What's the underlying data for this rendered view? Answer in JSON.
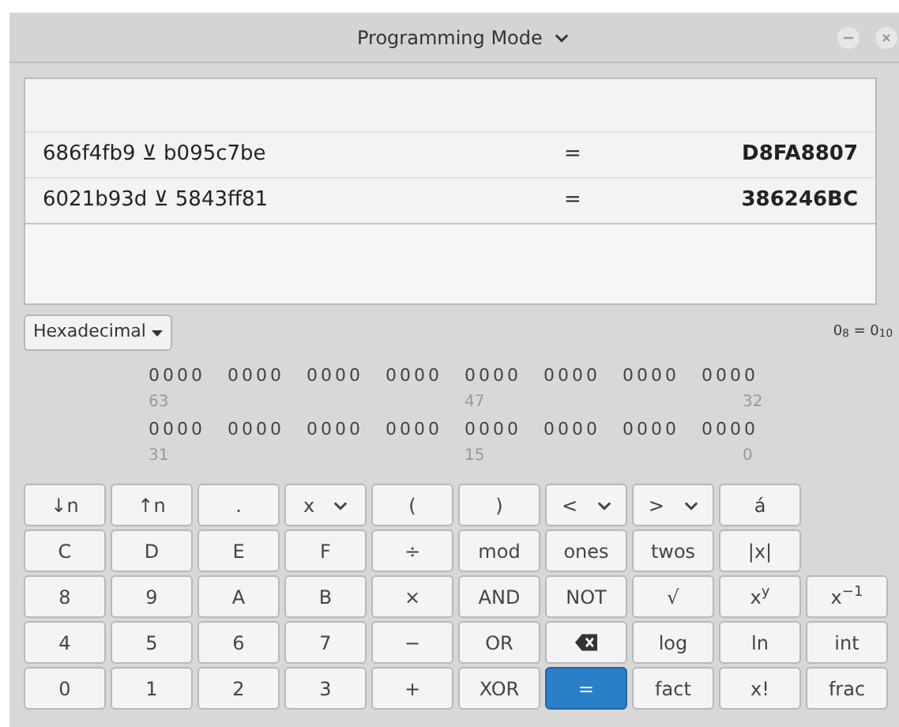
{
  "window": {
    "title": "Programming Mode"
  },
  "history": [
    {
      "expression": "686f4fb9 ⊻ b095c7be",
      "equals": "=",
      "result": "D8FA8807"
    },
    {
      "expression": "6021b93d ⊻ 5843ff81",
      "equals": "=",
      "result": "386246BC"
    }
  ],
  "number_format": {
    "label": "Hexadecimal"
  },
  "conversion": "0$_{8}$ = 0$_{10}$",
  "bits": [
    {
      "groups": [
        "0000",
        "0000",
        "0000",
        "0000",
        "0000",
        "0000",
        "0000",
        "0000"
      ],
      "labels": [
        "63",
        "47",
        "32"
      ]
    },
    {
      "groups": [
        "0000",
        "0000",
        "0000",
        "0000",
        "0000",
        "0000",
        "0000",
        "0000"
      ],
      "labels": [
        "31",
        "15",
        "0"
      ]
    }
  ],
  "keypad": [
    [
      {
        "label": "↓n",
        "kind": "key"
      },
      {
        "label": "↑n",
        "kind": "key"
      },
      {
        "label": ".",
        "kind": "key"
      },
      {
        "label": "x",
        "kind": "dropdown"
      },
      {
        "label": "(",
        "kind": "key"
      },
      {
        "label": ")",
        "kind": "key"
      },
      {
        "label": "<",
        "kind": "dropdown"
      },
      {
        "label": ">",
        "kind": "dropdown"
      },
      {
        "label": "á",
        "kind": "key"
      }
    ],
    [
      {
        "label": "C",
        "kind": "key"
      },
      {
        "label": "D",
        "kind": "key"
      },
      {
        "label": "E",
        "kind": "key"
      },
      {
        "label": "F",
        "kind": "key"
      },
      {
        "label": "÷",
        "kind": "key"
      },
      {
        "label": "mod",
        "kind": "key"
      },
      {
        "label": "ones",
        "kind": "key"
      },
      {
        "label": "twos",
        "kind": "key"
      },
      {
        "label": "|x|",
        "kind": "key"
      }
    ],
    [
      {
        "label": "8",
        "kind": "key"
      },
      {
        "label": "9",
        "kind": "key"
      },
      {
        "label": "A",
        "kind": "key"
      },
      {
        "label": "B",
        "kind": "key"
      },
      {
        "label": "×",
        "kind": "key"
      },
      {
        "label": "AND",
        "kind": "key"
      },
      {
        "label": "NOT",
        "kind": "key"
      },
      {
        "label": "√",
        "kind": "key"
      },
      {
        "label": "x$^{y}$",
        "kind": "key"
      },
      {
        "label": "x$^{−1}$",
        "kind": "key"
      }
    ],
    [
      {
        "label": "4",
        "kind": "key"
      },
      {
        "label": "5",
        "kind": "key"
      },
      {
        "label": "6",
        "kind": "key"
      },
      {
        "label": "7",
        "kind": "key"
      },
      {
        "label": "−",
        "kind": "key"
      },
      {
        "label": "OR",
        "kind": "key"
      },
      {
        "kind": "backspace"
      },
      {
        "label": "log",
        "kind": "key"
      },
      {
        "label": "ln",
        "kind": "key"
      },
      {
        "label": "int",
        "kind": "key"
      }
    ],
    [
      {
        "label": "0",
        "kind": "key"
      },
      {
        "label": "1",
        "kind": "key"
      },
      {
        "label": "2",
        "kind": "key"
      },
      {
        "label": "3",
        "kind": "key"
      },
      {
        "label": "+",
        "kind": "key"
      },
      {
        "label": "XOR",
        "kind": "key"
      },
      {
        "label": "=",
        "kind": "suggested"
      },
      {
        "label": "fact",
        "kind": "key"
      },
      {
        "label": "x!",
        "kind": "key"
      },
      {
        "label": "frac",
        "kind": "key"
      }
    ]
  ]
}
